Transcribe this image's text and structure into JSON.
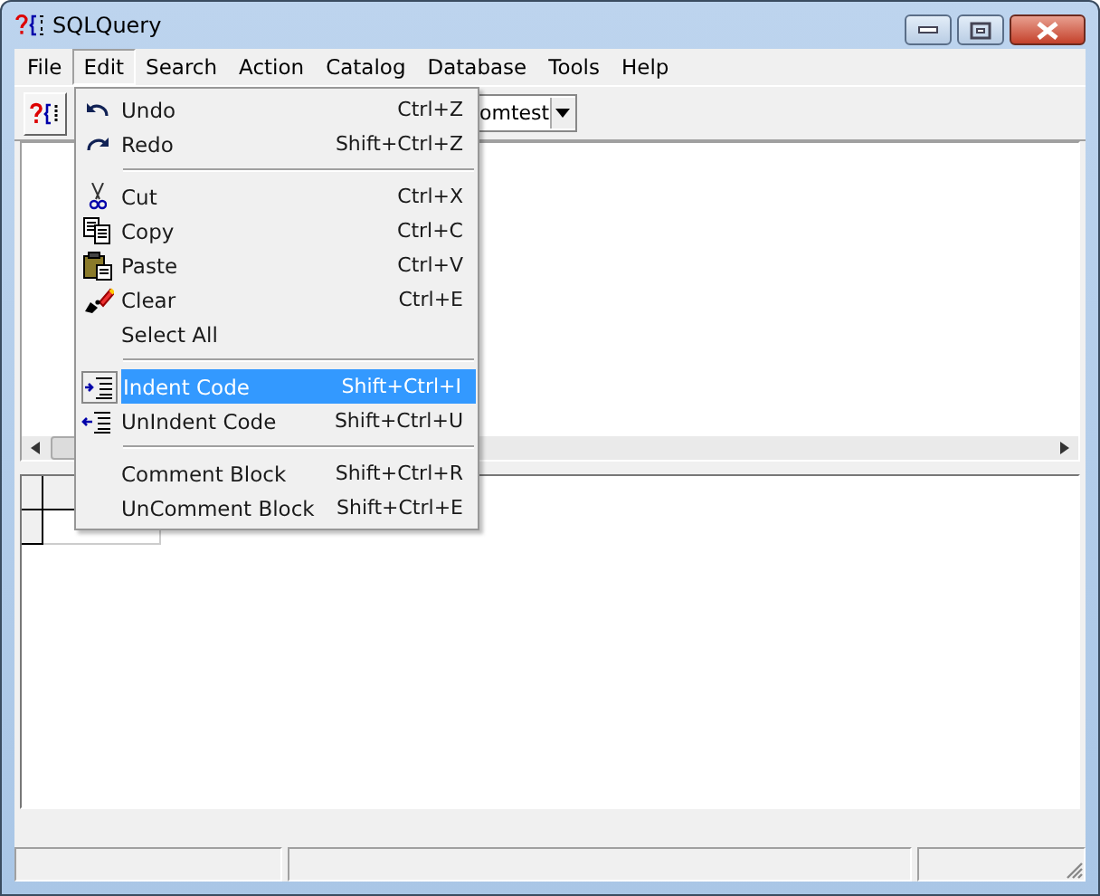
{
  "window": {
    "title": "SQLQuery"
  },
  "menu_bar": [
    {
      "label": "File",
      "selected": false
    },
    {
      "label": "Edit",
      "selected": true
    },
    {
      "label": "Search",
      "selected": false
    },
    {
      "label": "Action",
      "selected": false
    },
    {
      "label": "Catalog",
      "selected": false
    },
    {
      "label": "Database",
      "selected": false
    },
    {
      "label": "Tools",
      "selected": false
    },
    {
      "label": "Help",
      "selected": false
    }
  ],
  "toolbar": {
    "database_combo": {
      "value": "omtest"
    }
  },
  "edit_menu": [
    {
      "kind": "item",
      "label": "Undo",
      "shortcut": "Ctrl+Z",
      "selected": false
    },
    {
      "kind": "item",
      "label": "Redo",
      "shortcut": "Shift+Ctrl+Z",
      "selected": false
    },
    {
      "kind": "separator"
    },
    {
      "kind": "item",
      "label": "Cut",
      "shortcut": "Ctrl+X",
      "selected": false
    },
    {
      "kind": "item",
      "label": "Copy",
      "shortcut": "Ctrl+C",
      "selected": false
    },
    {
      "kind": "item",
      "label": "Paste",
      "shortcut": "Ctrl+V",
      "selected": false
    },
    {
      "kind": "item",
      "label": "Clear",
      "shortcut": "Ctrl+E",
      "selected": false
    },
    {
      "kind": "item",
      "label": "Select All",
      "selected": false
    },
    {
      "kind": "separator"
    },
    {
      "kind": "item",
      "label": "Indent Code",
      "shortcut": "Shift+Ctrl+I",
      "selected": true
    },
    {
      "kind": "item",
      "label": "UnIndent Code",
      "shortcut": "Shift+Ctrl+U",
      "selected": false
    },
    {
      "kind": "separator"
    },
    {
      "kind": "item",
      "label": "Comment Block",
      "shortcut": "Shift+Ctrl+R",
      "selected": false
    },
    {
      "kind": "item",
      "label": "UnComment Block",
      "shortcut": "Shift+Ctrl+E",
      "selected": false
    }
  ]
}
